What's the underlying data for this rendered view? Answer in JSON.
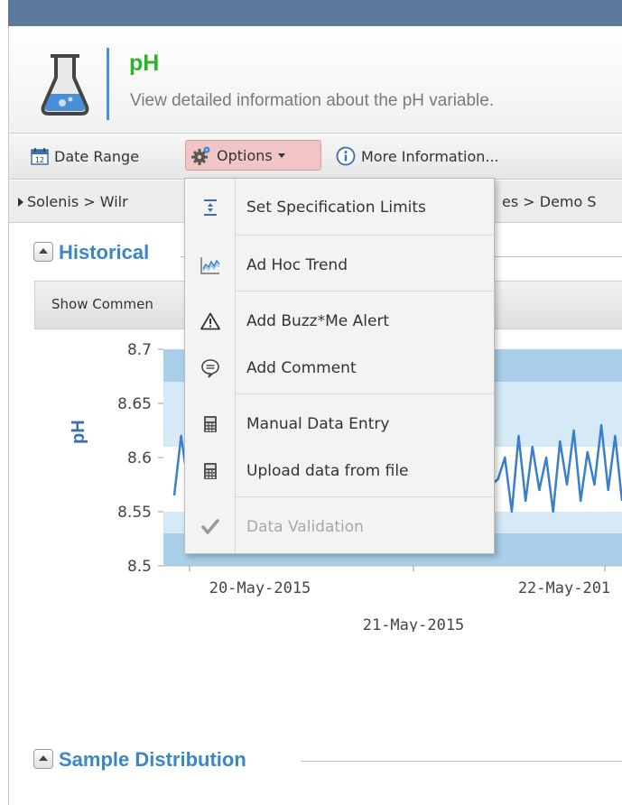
{
  "page": {
    "title": "pH",
    "subtitle": "View detailed information about the pH variable."
  },
  "toolbar": {
    "date_range": "Date Range",
    "options": "Options",
    "more_information": "More Information..."
  },
  "breadcrumb": {
    "left": "Solenis > Wilr",
    "right": "es > Demo S"
  },
  "sections": {
    "historical": "Historical",
    "sample_distribution": "Sample Distribution"
  },
  "comment_bar": {
    "label": "Show Commen"
  },
  "options_menu": {
    "items": [
      {
        "label": "Set Specification Limits",
        "icon": "spec-limits-icon",
        "disabled": false
      },
      {
        "label": "Ad Hoc Trend",
        "icon": "trend-chart-icon",
        "disabled": false
      },
      {
        "label": "Add Buzz*Me Alert",
        "icon": "warning-triangle-icon",
        "disabled": false
      },
      {
        "label": "Add Comment",
        "icon": "speech-bubble-icon",
        "disabled": false
      },
      {
        "label": "Manual Data Entry",
        "icon": "calculator-icon",
        "disabled": false
      },
      {
        "label": "Upload data from file",
        "icon": "calculator-icon",
        "disabled": false
      },
      {
        "label": "Data Validation",
        "icon": "checkmark-icon",
        "disabled": true
      }
    ]
  },
  "colors": {
    "header_bar": "#5b7a9c",
    "title_green": "#2bb52b",
    "accent_blue": "#3a87c8",
    "spec_band": "#a9cfe9",
    "line": "#3a7fcf"
  },
  "chart_data": {
    "type": "line",
    "ylabel": "pH",
    "yticks": [
      "8.7",
      "8.65",
      "8.6",
      "8.55",
      "8.5"
    ],
    "ylim": [
      8.5,
      8.7
    ],
    "xticks": [
      "20-May-2015",
      "21-May-2015",
      "22-May-201"
    ],
    "series": [
      {
        "values": [
          8.565,
          8.62,
          8.575,
          8.6,
          8.57,
          8.59,
          8.58,
          8.575,
          8.59,
          8.585,
          8.57,
          8.58,
          8.56,
          8.59,
          8.575,
          8.58,
          8.59,
          8.575,
          8.57,
          8.585,
          8.575,
          8.57,
          8.59,
          8.58,
          8.575,
          8.585,
          8.575,
          8.57,
          8.59,
          8.575,
          8.58,
          8.6,
          8.575,
          8.565,
          8.59,
          8.58,
          8.6,
          8.575,
          8.58,
          8.595,
          8.565,
          8.59,
          8.55,
          8.6,
          8.565,
          8.6,
          8.575,
          8.58,
          8.6,
          8.55,
          8.62,
          8.56,
          8.61,
          8.57,
          8.6,
          8.55,
          8.615,
          8.575,
          8.625,
          8.56,
          8.605,
          8.575,
          8.63,
          8.57,
          8.62,
          8.56
        ]
      }
    ]
  }
}
